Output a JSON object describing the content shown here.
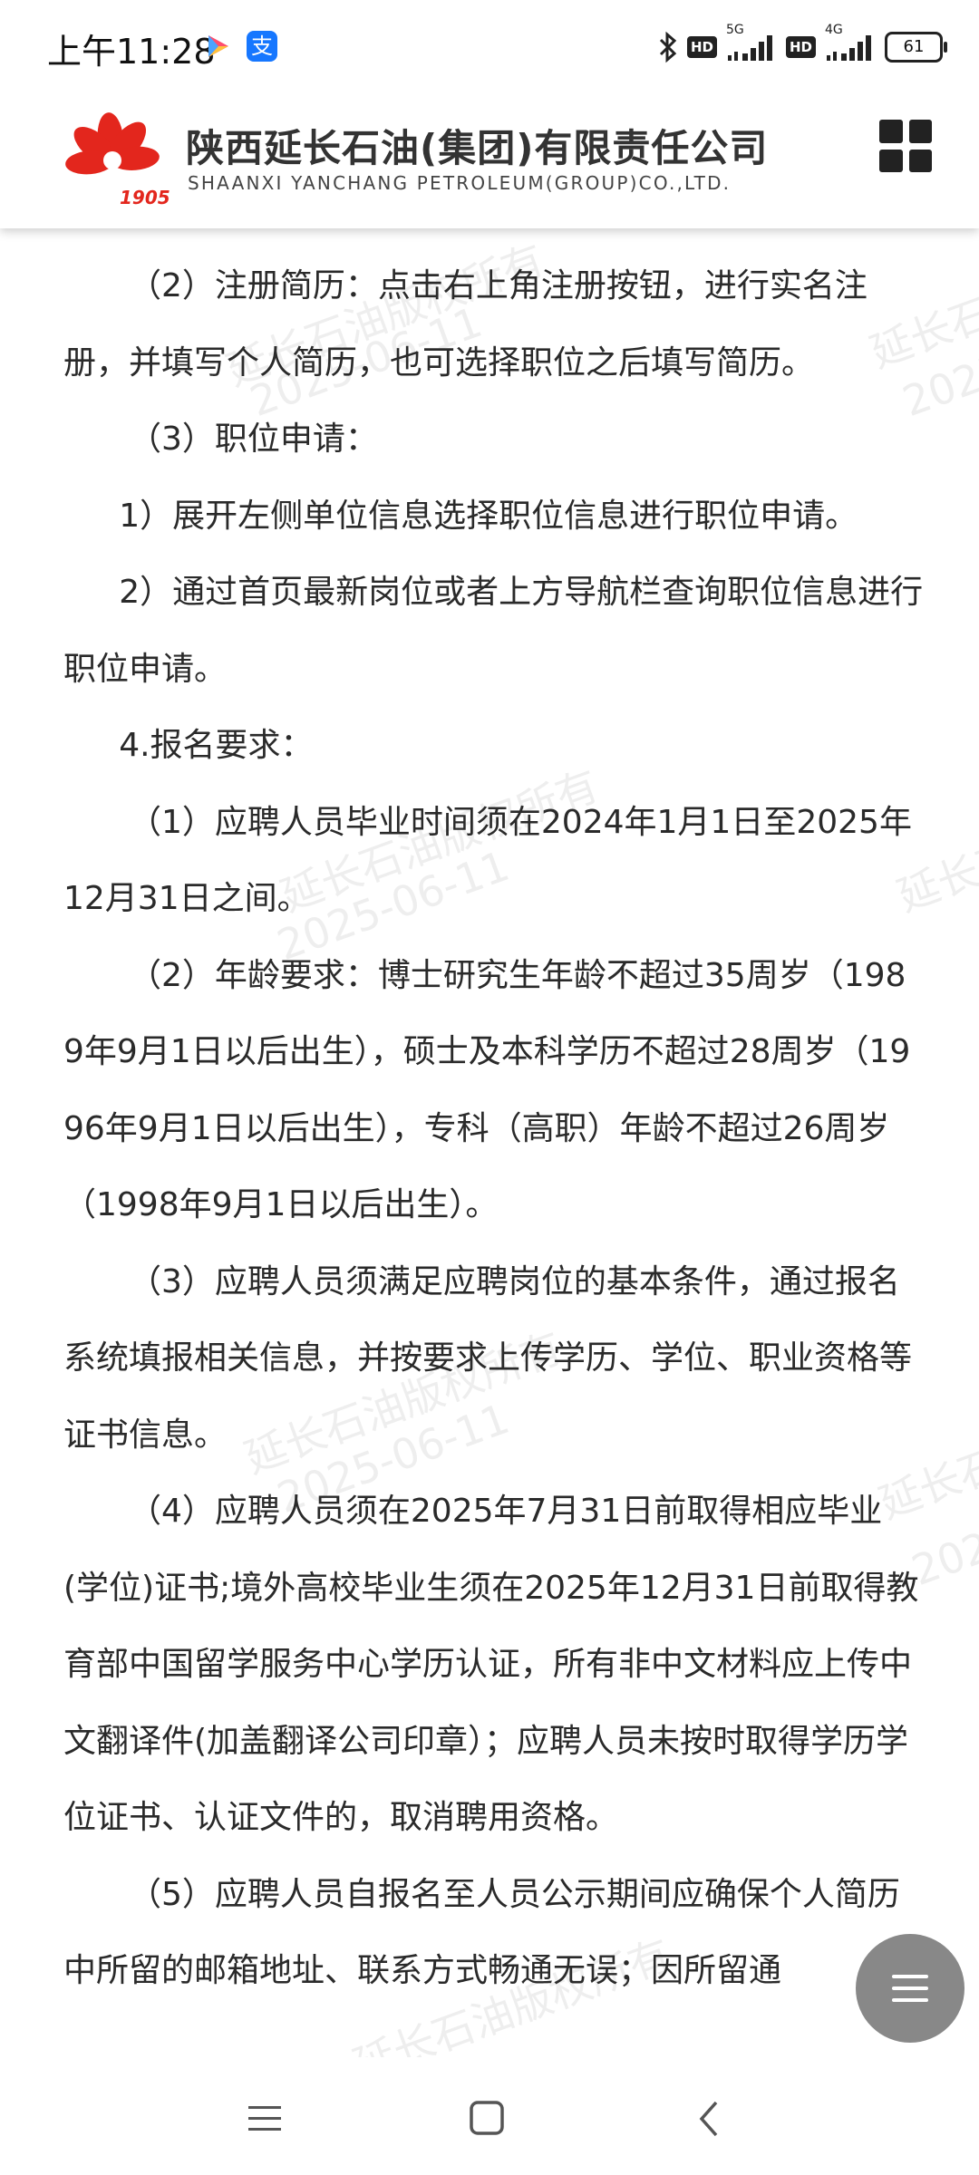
{
  "status_bar": {
    "time": "上午11:28",
    "alipay_icon_text": "支",
    "network_1": "5G",
    "network_2": "4G",
    "hd_label": "HD",
    "battery": "61",
    "icons": [
      "video-app-icon",
      "alipay-icon",
      "bluetooth-icon",
      "signal-icon",
      "battery-icon"
    ]
  },
  "header": {
    "logo_year": "1905",
    "company_name": "陕西延长石油(集团)有限责任公司",
    "company_name_en": "SHAANXI YANCHANG PETROLEUM(GROUP)CO.,LTD.",
    "brand_color": "#e3261d"
  },
  "watermark": {
    "text": "延长石油版权所有",
    "date": "2025-06-11"
  },
  "article": {
    "paragraphs": [
      "（2）注册简历：点击右上角注册按钮，进行实名注册，并填写个人简历，也可选择职位之后填写简历。",
      "（3）职位申请：",
      "1）展开左侧单位信息选择职位信息进行职位申请。",
      "2）通过首页最新岗位或者上方导航栏查询职位信息进行职位申请。",
      "4.报名要求：",
      "（1）应聘人员毕业时间须在2024年1月1日至2025年12月31日之间。",
      "（2）年龄要求：博士研究生年龄不超过35周岁（1989年9月1日以后出生），硕士及本科学历不超过28周岁（1996年9月1日以后出生），专科（高职）年龄不超过26周岁（1998年9月1日以后出生）。",
      "（3）应聘人员须满足应聘岗位的基本条件，通过报名系统填报相关信息，并按要求上传学历、学位、职业资格等证书信息。",
      "（4）应聘人员须在2025年7月31日前取得相应毕业(学位)证书;境外高校毕业生须在2025年12月31日前取得教育部中国留学服务中心学历认证，所有非中文材料应上传中文翻译件(加盖翻译公司印章）；应聘人员未按时取得学历学位证书、认证文件的，取消聘用资格。",
      "（5）应聘人员自报名至人员公示期间应确保个人简历中所留的邮箱地址、联系方式畅通无误；因所留通"
    ]
  },
  "nav_bar": {
    "icons": [
      "recent-apps-icon",
      "home-icon",
      "back-icon"
    ]
  }
}
